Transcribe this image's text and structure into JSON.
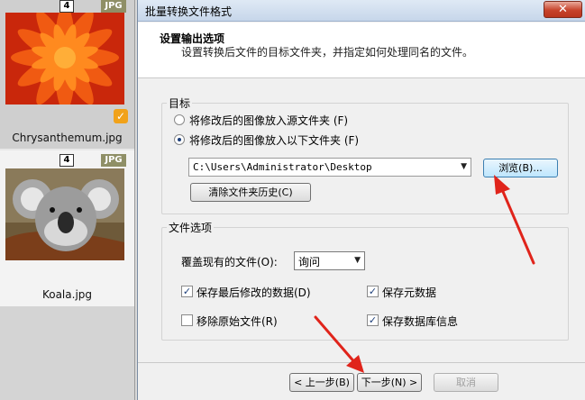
{
  "thumbnails": [
    {
      "number": "4",
      "format": "JPG",
      "name": "Chrysanthemum.jpg",
      "selected": true
    },
    {
      "number": "4",
      "format": "JPG",
      "name": "Koala.jpg",
      "selected": false
    }
  ],
  "dialog": {
    "title": "批量转换文件格式",
    "close_label": "✕",
    "header_title": "设置输出选项",
    "header_subtitle": "设置转换后文件的目标文件夹，并指定如何处理同名的文件。",
    "target": {
      "group_label": "目标",
      "option_source": "将修改后的图像放入源文件夹 (F)",
      "option_folder": "将修改后的图像放入以下文件夹 (F)",
      "selected_option": "folder",
      "path": "C:\\Users\\Administrator\\Desktop",
      "browse_label": "浏览(B)...",
      "clear_history_label": "清除文件夹历史(C)"
    },
    "file_options": {
      "group_label": "文件选项",
      "overwrite_label": "覆盖现有的文件(O):",
      "overwrite_value": "询问",
      "keep_modified_label": "保存最后修改的数据(D)",
      "keep_modified_checked": true,
      "keep_metadata_label": "保存元数据",
      "keep_metadata_checked": true,
      "remove_original_label": "移除原始文件(R)",
      "remove_original_checked": false,
      "keep_db_label": "保存数据库信息",
      "keep_db_checked": true
    },
    "footer": {
      "back_label": "< 上一步(B)",
      "next_label": "下一步(N) >",
      "cancel_label": "取消"
    }
  },
  "colors": {
    "annotation_arrow": "#e0241b",
    "badge_format": "#8f8f66",
    "check_badge": "#f1a21a"
  }
}
